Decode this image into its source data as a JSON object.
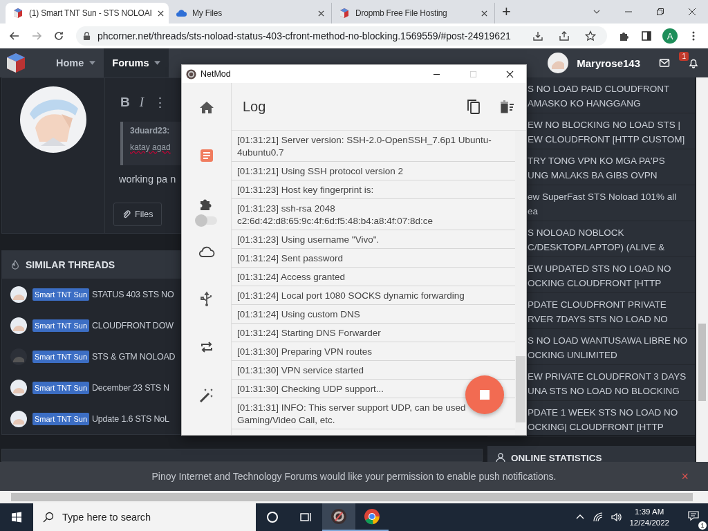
{
  "browser": {
    "tabs": [
      {
        "title": "(1) Smart TNT Sun - STS NOLOAI",
        "selected": true
      },
      {
        "title": "My Files",
        "selected": false
      },
      {
        "title": "Dropmb Free File Hosting",
        "selected": false
      }
    ],
    "new_tab": "+",
    "url": "phcorner.net/threads/sts-noload-status-403-cfront-method-no-blocking.1569559/#post-24919621",
    "profile": "A"
  },
  "forum_nav": {
    "items": [
      {
        "label": "Home",
        "selected": false
      },
      {
        "label": "Forums",
        "selected": true
      }
    ],
    "username": "Maryrose143",
    "alert_count": "1"
  },
  "editor": {
    "toolbar": [
      "B",
      "I",
      "⋮"
    ],
    "quote_author": "3duard23:",
    "quote_text": "katay agad",
    "text": "working pa n",
    "files_button": "Files"
  },
  "similar_threads": {
    "title": "SIMILAR THREADS",
    "rows": [
      {
        "tag": "Smart TNT Sun",
        "title": "STATUS 403 STS NO"
      },
      {
        "tag": "Smart TNT Sun",
        "title": "CLOUDFRONT DOW"
      },
      {
        "tag": "Smart TNT Sun",
        "title": "STS & GTM NOLOAD"
      },
      {
        "tag": "Smart TNT Sun",
        "title": "December 23 STS N"
      },
      {
        "tag": "Smart TNT Sun",
        "title": "Update 1.6 STS NoL"
      }
    ]
  },
  "sidebar_threads": [
    {
      "lines": [
        "S NO LOAD PAID CLOUDFRONT",
        "AMASKO KO HANGGANG"
      ]
    },
    {
      "lines": [
        "EW NO BLOCKING NO LOAD STS |",
        "EW CLOUDFRONT [HTTP CUSTOM]"
      ]
    },
    {
      "lines": [
        "TRY TONG VPN KO MGA PA'PS",
        "UNG MALAKS BA GIBS OVPN"
      ]
    },
    {
      "lines": [
        "ew SuperFast STS Noload 101% all",
        "ea"
      ]
    },
    {
      "lines": [
        "S NOLOAD NOBLOCK",
        "C/DESKTOP/LAPTOP) (ALIVE &"
      ]
    },
    {
      "lines": [
        "EW UPDATED STS NO LOAD NO",
        "OCKING CLOUDFRONT [HTTP"
      ]
    },
    {
      "lines": [
        "PDATE CLOUDFRONT PRIVATE",
        "RVER 7DAYS STS NO LOAD NO"
      ]
    },
    {
      "lines": [
        "S NO LOAD WANTUSAWA LIBRE NO",
        "OCKING UNLIMITED"
      ]
    },
    {
      "lines": [
        "EW PRIVATE CLOUDFRONT 3 DAYS",
        "UNA STS NO LOAD NO BLOCKING"
      ]
    },
    {
      "lines": [
        "PDATE 1 WEEK STS NO LOAD NO",
        "OCKING| CLOUDFRONT [HTTP"
      ]
    }
  ],
  "online_statistics": {
    "title": "ONLINE STATISTICS"
  },
  "notification": {
    "text": "Pinoy Internet and Technology Forums would like your permission to enable push notifications.",
    "close": "×"
  },
  "netmod": {
    "title": "NetMod",
    "heading": "Log",
    "nav": [
      {
        "kind": "home",
        "selected": false
      },
      {
        "kind": "log",
        "selected": true
      },
      {
        "kind": "plugin",
        "selected": false,
        "on": false
      },
      {
        "kind": "cloud",
        "selected": false
      },
      {
        "kind": "usb",
        "selected": false
      },
      {
        "kind": "repeat",
        "selected": false
      },
      {
        "kind": "wand",
        "selected": false
      }
    ],
    "log": [
      "[01:31:21] Server version: SSH-2.0-OpenSSH_7.6p1 Ubuntu-4ubuntu0.7",
      "[01:31:21] Using SSH protocol version 2",
      "[01:31:23] Host key fingerprint is:",
      "[01:31:23] ssh-rsa 2048 c2:6d:42:d8:65:9c:4f:6d:f5:48:b4:a8:4f:07:8d:ce",
      "[01:31:23] Using username \"Vivo\".",
      "[01:31:24] Sent password",
      "[01:31:24] Access granted",
      "[01:31:24] Local port 1080 SOCKS dynamic forwarding",
      "[01:31:24] Using custom DNS",
      "[01:31:24] Starting DNS Forwarder",
      "[01:31:30] Preparing VPN routes",
      "[01:31:30] VPN service started",
      "[01:31:30] Checking UDP support...",
      "[01:31:31] INFO: This server support UDP, can be used Gaming/Video Call, etc."
    ]
  },
  "taskbar": {
    "search_placeholder": "Type here to search",
    "time": "1:39 AM",
    "date": "12/24/2022",
    "notification_count": "1"
  }
}
